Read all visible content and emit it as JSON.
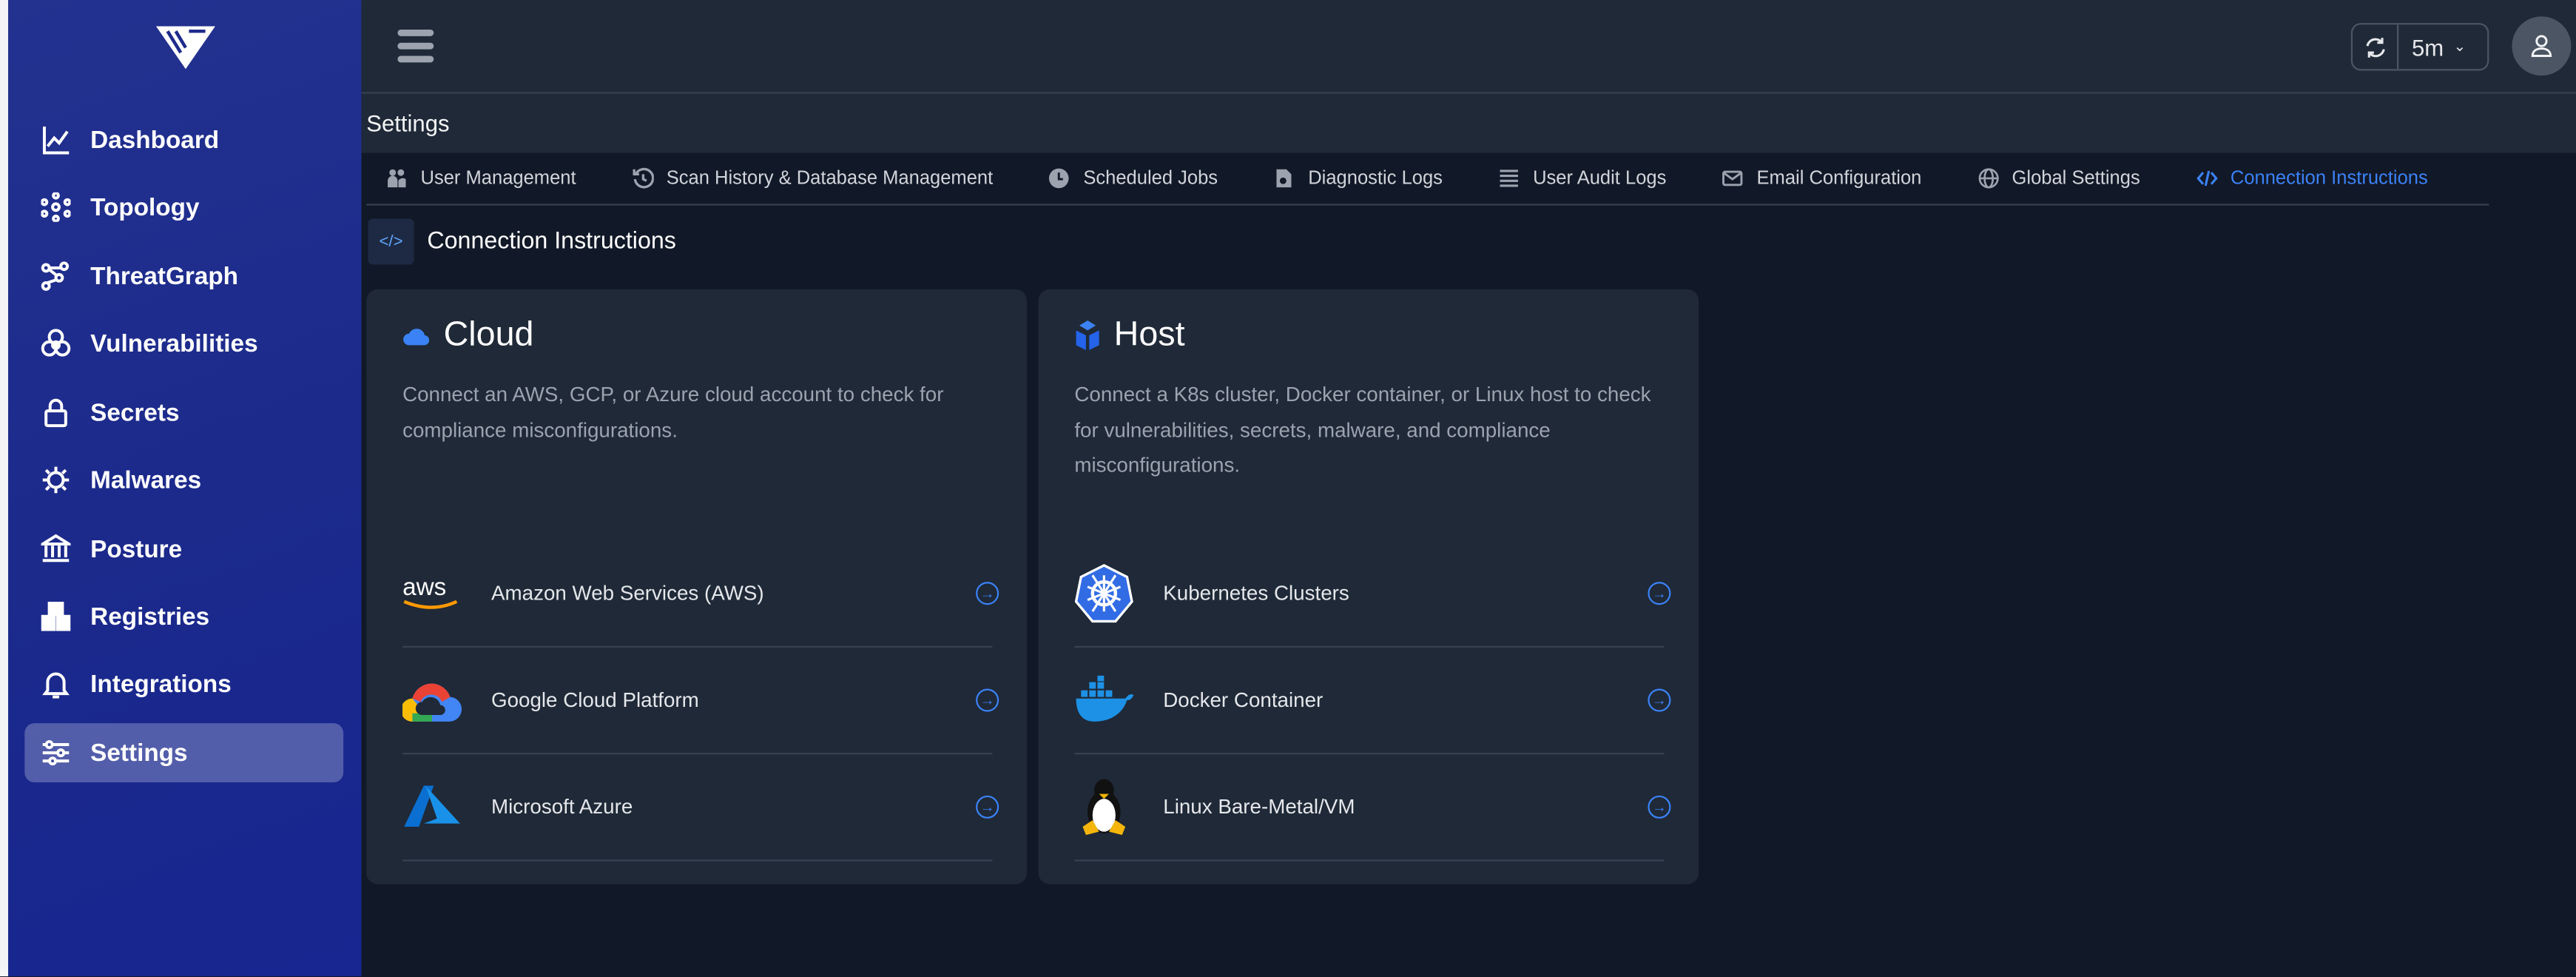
{
  "sidebar": {
    "items": [
      {
        "label": "Dashboard",
        "icon": "chart-line-icon"
      },
      {
        "label": "Topology",
        "icon": "topology-icon"
      },
      {
        "label": "ThreatGraph",
        "icon": "threatgraph-icon"
      },
      {
        "label": "Vulnerabilities",
        "icon": "biohazard-icon"
      },
      {
        "label": "Secrets",
        "icon": "lock-icon"
      },
      {
        "label": "Malwares",
        "icon": "virus-icon"
      },
      {
        "label": "Posture",
        "icon": "bank-icon"
      },
      {
        "label": "Registries",
        "icon": "boxes-icon"
      },
      {
        "label": "Integrations",
        "icon": "bell-icon"
      },
      {
        "label": "Settings",
        "icon": "sliders-icon",
        "active": true
      }
    ]
  },
  "topbar": {
    "refresh_interval": "5m"
  },
  "page": {
    "title": "Settings"
  },
  "tabs": [
    {
      "label": "User Management"
    },
    {
      "label": "Scan History & Database Management"
    },
    {
      "label": "Scheduled Jobs"
    },
    {
      "label": "Diagnostic Logs"
    },
    {
      "label": "User Audit Logs"
    },
    {
      "label": "Email Configuration"
    },
    {
      "label": "Global Settings"
    },
    {
      "label": "Connection Instructions",
      "active": true
    }
  ],
  "section": {
    "title": "Connection Instructions"
  },
  "cards": {
    "cloud": {
      "title": "Cloud",
      "description": "Connect an AWS, GCP, or Azure cloud account to check for compliance misconfigurations.",
      "items": [
        {
          "label": "Amazon Web Services (AWS)"
        },
        {
          "label": "Google Cloud Platform"
        },
        {
          "label": "Microsoft Azure"
        }
      ]
    },
    "host": {
      "title": "Host",
      "description": "Connect a K8s cluster, Docker container, or Linux host to check for vulnerabilities, secrets, malware, and compliance misconfigurations.",
      "items": [
        {
          "label": "Kubernetes Clusters"
        },
        {
          "label": "Docker Container"
        },
        {
          "label": "Linux Bare-Metal/VM"
        }
      ]
    }
  },
  "colors": {
    "accent": "#3b82f6",
    "sidebar": "#1c2a8c",
    "background": "#111827",
    "card": "#1f2937"
  }
}
